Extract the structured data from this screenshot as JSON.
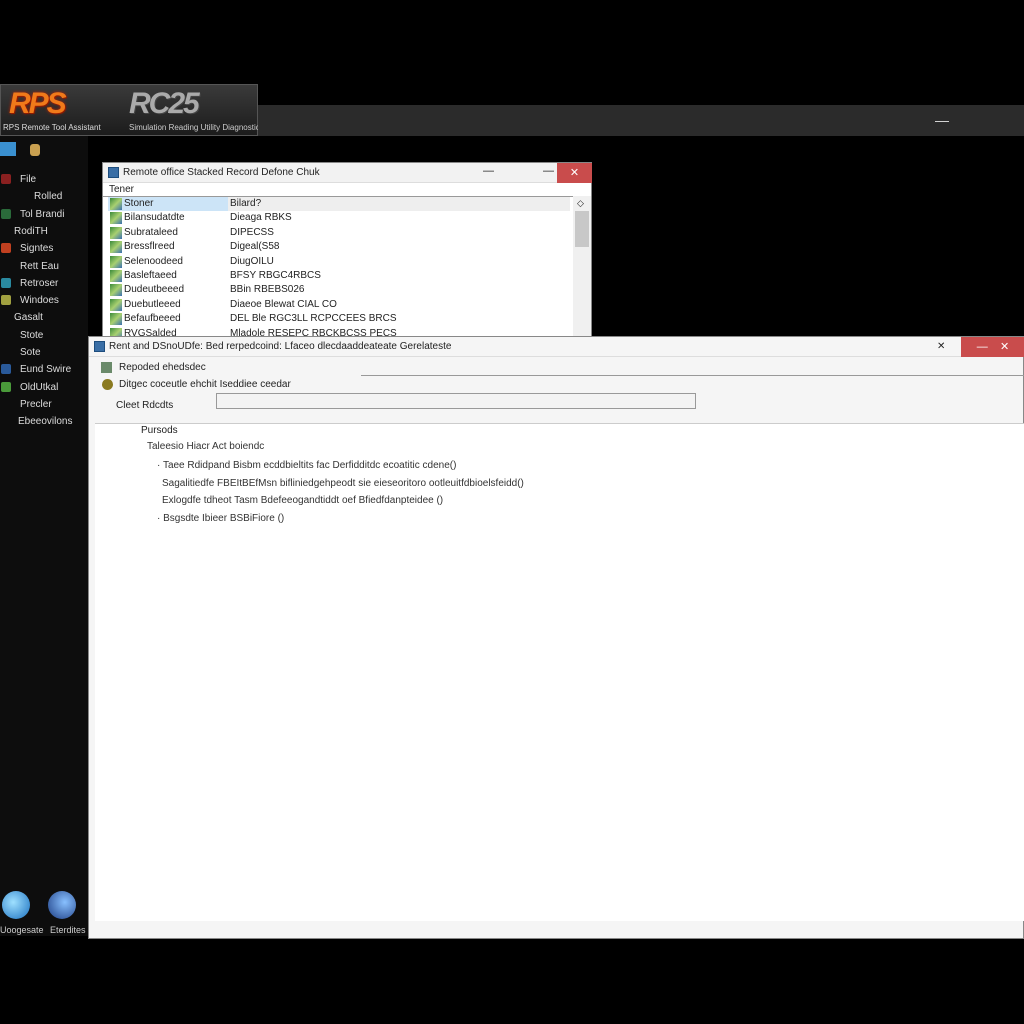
{
  "banner": {
    "logo_left": "RPS",
    "logo_right": "RC25",
    "subtitle_left": "RPS Remote Tool Assistant",
    "subtitle_right": "Simulation Reading Utility Diagnostic Console"
  },
  "sidebar": {
    "items": [
      {
        "label": "File",
        "color": "#8a2020"
      },
      {
        "label": "Rolled",
        "color": ""
      },
      {
        "label": "Tol Brandi",
        "color": "#2a6a3a"
      },
      {
        "label": "RodiTH",
        "color": ""
      },
      {
        "label": "Signtes",
        "color": "#c04020"
      },
      {
        "label": "Rett Eau",
        "color": ""
      },
      {
        "label": "Retroser",
        "color": "#2a8aa0"
      },
      {
        "label": "Windoes",
        "color": "#a0a040"
      },
      {
        "label": "Gasalt",
        "color": ""
      },
      {
        "label": "Stote",
        "color": ""
      },
      {
        "label": "Sote",
        "color": ""
      },
      {
        "label": "Eund Swire",
        "color": "#2a5a9a"
      },
      {
        "label": "OldUtkal",
        "color": "#4a9a3a"
      },
      {
        "label": "Precler",
        "color": ""
      },
      {
        "label": "Ebeeovilons",
        "color": ""
      }
    ]
  },
  "window1": {
    "title": "Remote office Stacked Record Defone Chuk",
    "column_header": "Tener",
    "rows": [
      {
        "name": "Stoner",
        "value": "Bilard?"
      },
      {
        "name": "Bilansudatdte",
        "value": "Dieaga RBKS"
      },
      {
        "name": "Subrataleed",
        "value": "DIPECSS"
      },
      {
        "name": "Bressflreed",
        "value": "Digeal(S58"
      },
      {
        "name": "Selenoodeed",
        "value": "DiugOILU"
      },
      {
        "name": "Basleftaeed",
        "value": "BFSY RBGC4RBCS"
      },
      {
        "name": "Dudeutbeeed",
        "value": "BBin RBEBS026"
      },
      {
        "name": "Duebutleeed",
        "value": "Diaeoe Blewat CIAL CO"
      },
      {
        "name": "Befaufbeeed",
        "value": "DEL Ble RGC3LL RCPCCEES BRCS"
      },
      {
        "name": "RVGSalded",
        "value": "Mladole RESEPC RBCKBCSS PECS"
      }
    ]
  },
  "window2": {
    "title": "Rent and DSnoUDfe: Bed rerpedcoind: Lfaceo dlecdaaddeateate Gerelateste",
    "option1": "Repoded ehedsdec",
    "option2": "Ditgec coceutle ehchit Iseddiee ceedar",
    "field_label": "Cleet Rdcdts",
    "field_value": "",
    "group_label": "Pursods",
    "heading": "Taleesio Hiacr Act boiendc",
    "lines": [
      "Taee Rdidpand Bisbm ecddbieltits fac Derfidditdc ecoatitic cdene()",
      "Sagalitiedfe FBEItBEfMsn bifliniedgehpeodt sie eieseoritoro ootleuitfdbioelsfeidd()",
      "Exlogdfe tdheot Tasm Bdefeeogandtiddt oef Bfiedfdanpteidee ()",
      "Bsgsdte Ibieer BSBiFiore ()"
    ]
  },
  "desktop": {
    "icons": [
      {
        "label": "Uoogesate"
      },
      {
        "label": "Eterdites"
      }
    ]
  },
  "colors": {
    "close": "#c94c4c",
    "selected_row": "#cce4f7",
    "logo_orange": "#f07a1a"
  }
}
